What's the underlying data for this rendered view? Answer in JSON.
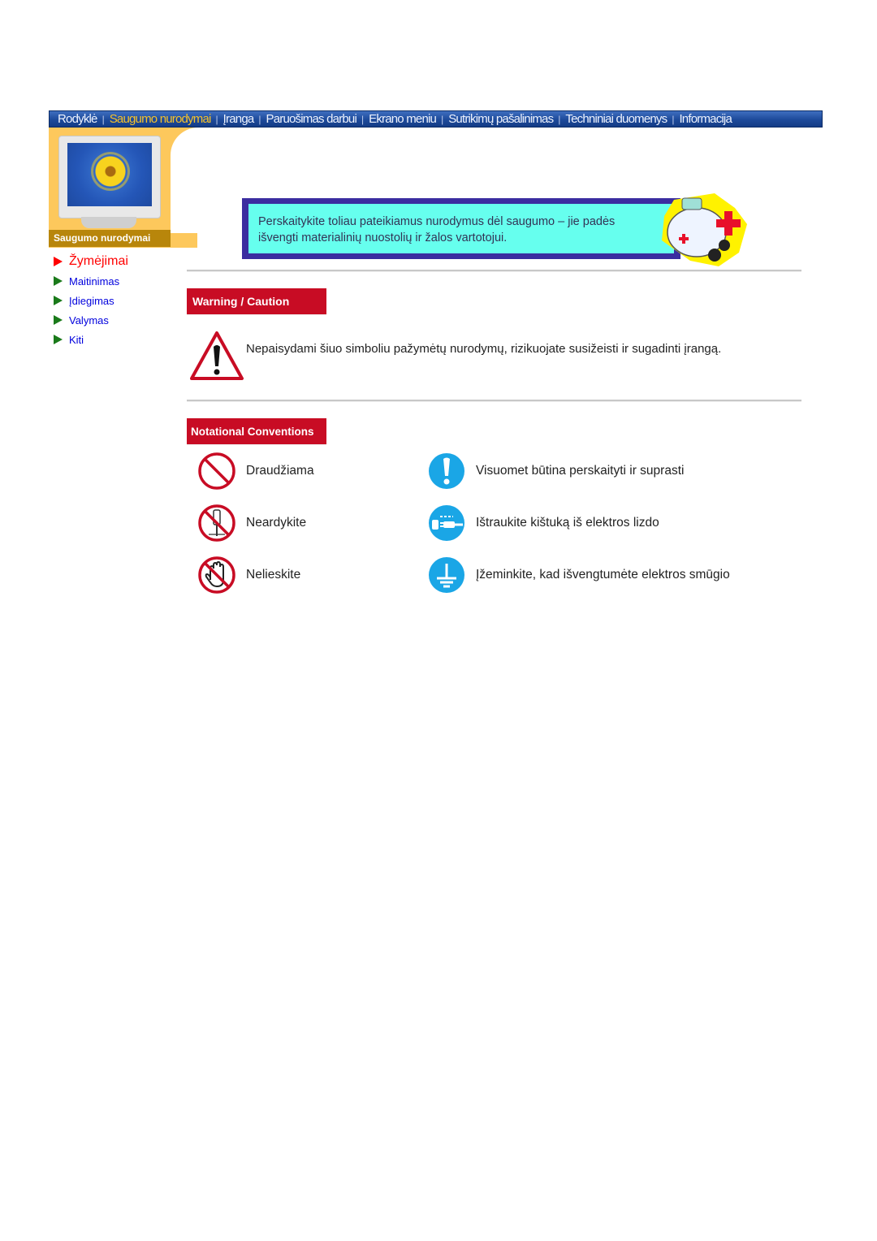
{
  "nav": {
    "items": [
      {
        "label": "Rodyklė",
        "active": false
      },
      {
        "label": "Saugumo nurodymai",
        "active": true
      },
      {
        "label": "Įranga",
        "active": false
      },
      {
        "label": "Paruošimas darbui",
        "active": false
      },
      {
        "label": "Ekrano meniu",
        "active": false
      },
      {
        "label": "Sutrikimų pašalinimas",
        "active": false
      },
      {
        "label": "Techniniai duomenys",
        "active": false
      },
      {
        "label": "Informacija",
        "active": false
      }
    ],
    "separator": "|"
  },
  "sidebar": {
    "title": "Saugumo nurodymai",
    "links": [
      {
        "label": "Žymėjimai",
        "active": true
      },
      {
        "label": "Maitinimas",
        "active": false
      },
      {
        "label": "Įdiegimas",
        "active": false
      },
      {
        "label": "Valymas",
        "active": false
      },
      {
        "label": "Kiti",
        "active": false
      }
    ]
  },
  "banner": {
    "line1": "Perskaitykite toliau pateikiamus nurodymus dėl saugumo – jie padės",
    "line2": "išvengti materialinių nuostolių ir žalos vartotojui."
  },
  "warning": {
    "heading": "Warning / Caution",
    "text": "Nepaisydami šiuo simboliu pažymėtų nurodymų, rizikuojate susižeisti ir sugadinti įrangą."
  },
  "conventions": {
    "heading": "Notational Conventions",
    "items": [
      {
        "icon": "prohibited-icon",
        "label": "Draudžiama"
      },
      {
        "icon": "must-read-icon",
        "label": "Visuomet būtina perskaityti ir suprasti"
      },
      {
        "icon": "do-not-disassemble-icon",
        "label": "Neardykite"
      },
      {
        "icon": "unplug-icon",
        "label": "Ištraukite kištuką iš elektros lizdo"
      },
      {
        "icon": "do-not-touch-icon",
        "label": "Nelieskite"
      },
      {
        "icon": "ground-icon",
        "label": "Įžeminkite, kad išvengtumėte elektros smūgio"
      }
    ]
  },
  "colors": {
    "nav_bg": "#1d4a9a",
    "nav_active": "#f5c12a",
    "heading_red": "#c80c24",
    "banner_bg": "#66ffee",
    "banner_border": "#3b2da0",
    "sidebar_gold": "#b8860b",
    "link_blue": "#0000dd",
    "info_blue": "#1aa6e6"
  }
}
